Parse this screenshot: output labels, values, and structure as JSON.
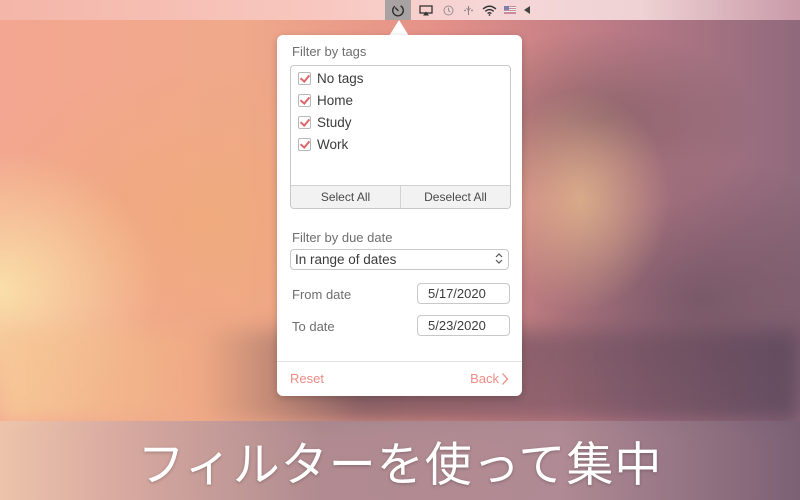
{
  "menubar": {
    "icons": [
      {
        "name": "app-timer-icon",
        "glyph": "⏲",
        "active": true
      },
      {
        "name": "airplay-icon",
        "glyph": "▭"
      },
      {
        "name": "time-machine-icon",
        "glyph": "◷"
      },
      {
        "name": "bluetooth-icon",
        "glyph": "✢"
      },
      {
        "name": "wifi-icon",
        "glyph": "◠"
      },
      {
        "name": "flag-us-icon",
        "glyph": "▬"
      },
      {
        "name": "volume-icon",
        "glyph": "◀"
      }
    ]
  },
  "popover": {
    "tags_section": {
      "label": "Filter by tags",
      "tags": [
        {
          "label": "No tags",
          "checked": true
        },
        {
          "label": "Home",
          "checked": true
        },
        {
          "label": "Study",
          "checked": true
        },
        {
          "label": "Work",
          "checked": true
        }
      ],
      "select_all_label": "Select All",
      "deselect_all_label": "Deselect All"
    },
    "date_section": {
      "label": "Filter by due date",
      "mode_value": "In range of dates",
      "from_label": "From date",
      "from_value": "5/17/2020",
      "to_label": "To date",
      "to_value": "5/23/2020"
    },
    "footer": {
      "reset_label": "Reset",
      "back_label": "Back",
      "accent_color": "#ef8c85"
    }
  },
  "caption": "フィルターを使って集中"
}
